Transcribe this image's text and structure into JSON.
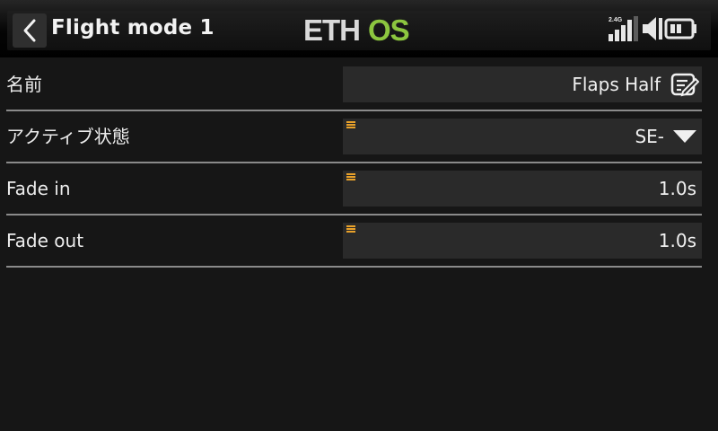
{
  "header": {
    "title": "Flight mode 1",
    "logo": {
      "text_main": "ETH",
      "text_accent": "OS",
      "accent_color": "#8cc63f",
      "main_color": "#d9d9d9"
    },
    "back_icon": "chevron-left-icon",
    "status": {
      "band_label": "2.4G",
      "signal_icon": "signal-bars-icon",
      "volume_icon": "speaker-muted-icon",
      "battery_icon": "battery-icon"
    }
  },
  "rows": [
    {
      "label": "名前",
      "value": "Flaps Half",
      "control": "edit-icon"
    },
    {
      "label": "アクティブ状態",
      "value": "SE-",
      "control": "dropdown-arrow-icon"
    },
    {
      "label": "Fade in",
      "value": "1.0s",
      "control": "none"
    },
    {
      "label": "Fade out",
      "value": "1.0s",
      "control": "none"
    }
  ],
  "colors": {
    "background": "#161616",
    "field": "#2a2a2a",
    "divider": "#8a8a8a",
    "marker": "#e8a12a"
  }
}
